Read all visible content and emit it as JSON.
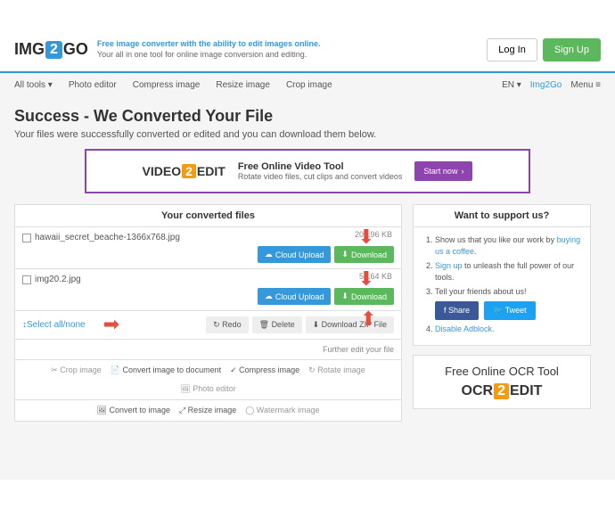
{
  "header": {
    "logo_pre": "IMG",
    "logo_num": "2",
    "logo_post": "GO",
    "tagline_main": "Free image converter with the ability to edit images online.",
    "tagline_sub": "Your all in one tool for online image conversion and editing.",
    "login": "Log In",
    "signup": "Sign Up"
  },
  "nav": {
    "items": [
      "All tools ▾",
      "Photo editor",
      "Compress image",
      "Resize image",
      "Crop image"
    ],
    "lang": "EN ▾",
    "brand": "Img2Go",
    "menu": "Menu ≡"
  },
  "page": {
    "title": "Success - We Converted Your File",
    "subtitle": "Your files were successfully converted or edited and you can download them below."
  },
  "ad": {
    "logo_pre": "VIDEO",
    "logo_num": "2",
    "logo_post": "EDIT",
    "title": "Free Online Video Tool",
    "sub": "Rotate video files, cut clips and convert videos",
    "btn": "Start now"
  },
  "converted": {
    "header": "Your converted files",
    "files": [
      {
        "name": "hawaii_secret_beache-1366x768.jpg",
        "size": "202.96 KB"
      },
      {
        "name": "img20.2.jpg",
        "size": "59.64 KB"
      }
    ],
    "cloud_upload": "Cloud Upload",
    "download": "Download",
    "select_all": "Select all/none",
    "redo": "Redo",
    "delete": "Delete",
    "download_zip": "Download ZIP File",
    "further": "Further edit your file",
    "tools_row1": [
      "✂ Crop image",
      "📄 Convert image to document",
      "✓ Compress image",
      "↻ Rotate image",
      "🖼 Photo editor"
    ],
    "tools_row2": [
      "🖼 Convert to image",
      "⤢ Resize image",
      "◯ Watermark image"
    ]
  },
  "support": {
    "header": "Want to support us?",
    "items": [
      {
        "pre": "Show us that you like our work by ",
        "link": "buying us a coffee",
        "post": "."
      },
      {
        "pre": "",
        "link": "Sign up",
        "post": " to unleash the full power of our tools."
      },
      {
        "pre": "Tell your friends about us!",
        "link": "",
        "post": ""
      }
    ],
    "share": "f Share",
    "tweet": "🐦 Tweet",
    "disable": "Disable Adblock."
  },
  "ocr": {
    "title": "Free Online OCR Tool",
    "logo_pre": "OCR",
    "logo_num": "2",
    "logo_post": "EDIT"
  }
}
